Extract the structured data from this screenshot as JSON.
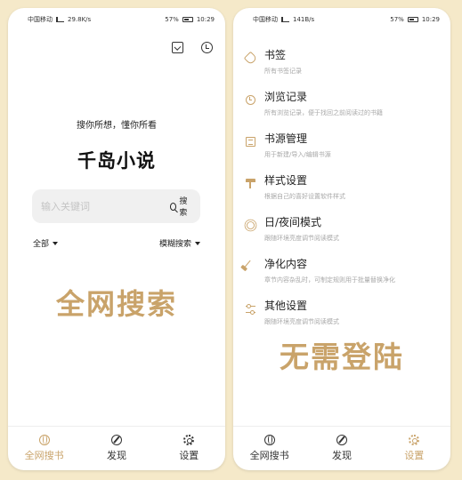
{
  "colors": {
    "accent": "#c9a36a",
    "background": "#f5e9c9",
    "text": "#222222",
    "muted": "#a8a8a8"
  },
  "left_phone": {
    "status": {
      "carrier": "中国移动",
      "speed": "29.8K/s",
      "battery": "57%",
      "time": "10:29"
    },
    "top_icons": [
      "download-icon",
      "history-icon"
    ],
    "slogan": "搜你所想，懂你所看",
    "app_title": "千岛小说",
    "search": {
      "placeholder": "输入关键词",
      "button_label": "搜索"
    },
    "filters": {
      "left": "全部",
      "right": "模糊搜索"
    },
    "watermark": "全网搜索",
    "tabs": [
      {
        "label": "全网搜书",
        "icon": "globe-icon",
        "active": true
      },
      {
        "label": "发现",
        "icon": "compass-icon",
        "active": false
      },
      {
        "label": "设置",
        "icon": "gear-icon",
        "active": false
      }
    ]
  },
  "right_phone": {
    "status": {
      "carrier": "中国移动",
      "speed": "141B/s",
      "battery": "57%",
      "time": "10:29"
    },
    "settings": [
      {
        "title": "书签",
        "desc": "所有书签记录",
        "icon": "bookmark-tag-icon"
      },
      {
        "title": "浏览记录",
        "desc": "所有浏览记录，便于找回之前阅读过的书籍",
        "icon": "clock-icon"
      },
      {
        "title": "书源管理",
        "desc": "用于新建/导入/编辑书源",
        "icon": "document-icon"
      },
      {
        "title": "样式设置",
        "desc": "根据自己的喜好设置软件样式",
        "icon": "paint-roller-icon"
      },
      {
        "title": "日/夜间模式",
        "desc": "跟随环境亮度调节阅读模式",
        "icon": "sun-icon"
      },
      {
        "title": "净化内容",
        "desc": "章节内容杂乱时，可制定规则用于批量替换净化",
        "icon": "broom-icon"
      },
      {
        "title": "其他设置",
        "desc": "跟随环境亮度调节阅读模式",
        "icon": "sliders-icon"
      }
    ],
    "watermark": "无需登陆",
    "tabs": [
      {
        "label": "全网搜书",
        "icon": "globe-icon",
        "active": false
      },
      {
        "label": "发现",
        "icon": "compass-icon",
        "active": false
      },
      {
        "label": "设置",
        "icon": "gear-icon",
        "active": true
      }
    ]
  }
}
